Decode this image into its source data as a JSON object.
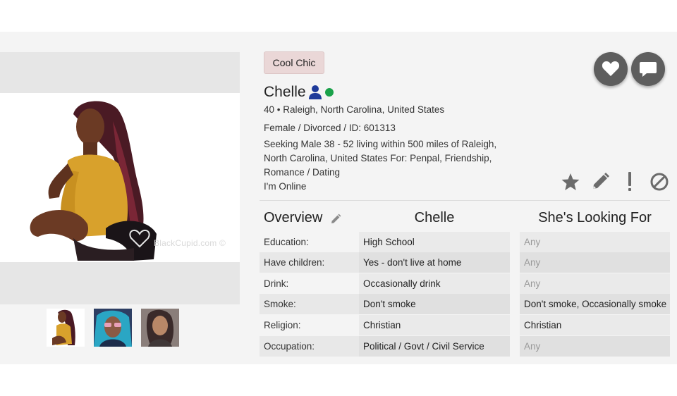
{
  "profile": {
    "badge": "Cool Chic",
    "name": "Chelle",
    "line_location": "40 • Raleigh, North Carolina, United States",
    "line_details": "Female / Divorced / ID: 601313",
    "line_seeking": "Seeking Male 38 - 52 living within 500 miles of Raleigh, North Carolina, United States For: Penpal, Friendship, Romance / Dating",
    "line_status": "I'm Online"
  },
  "photo": {
    "watermark": "BlackCupid.com ©"
  },
  "icons": {
    "favorite": "heart-icon",
    "message": "chat-bubble-icon",
    "member": "person-icon",
    "online": "online-dot",
    "actions": [
      "star-icon",
      "pencil-icon",
      "exclamation-icon",
      "block-icon"
    ]
  },
  "colors": {
    "accent_badge": "#ead7d7",
    "online": "#1aa14a",
    "member_icon": "#1e3a9a",
    "action_icon": "#6b6b6b"
  },
  "table": {
    "headers": {
      "overview": "Overview",
      "self": "Chelle",
      "looking": "She's Looking For"
    },
    "rows": [
      {
        "label": "Education:",
        "value": "High School",
        "want": "Any"
      },
      {
        "label": "Have children:",
        "value": "Yes - don't live at home",
        "want": "Any"
      },
      {
        "label": "Drink:",
        "value": "Occasionally drink",
        "want": "Any"
      },
      {
        "label": "Smoke:",
        "value": "Don't smoke",
        "want": "Don't smoke, Occasionally smoke"
      },
      {
        "label": "Religion:",
        "value": "Christian",
        "want": "Christian"
      },
      {
        "label": "Occupation:",
        "value": "Political / Govt / Civil Service",
        "want": "Any"
      }
    ]
  }
}
